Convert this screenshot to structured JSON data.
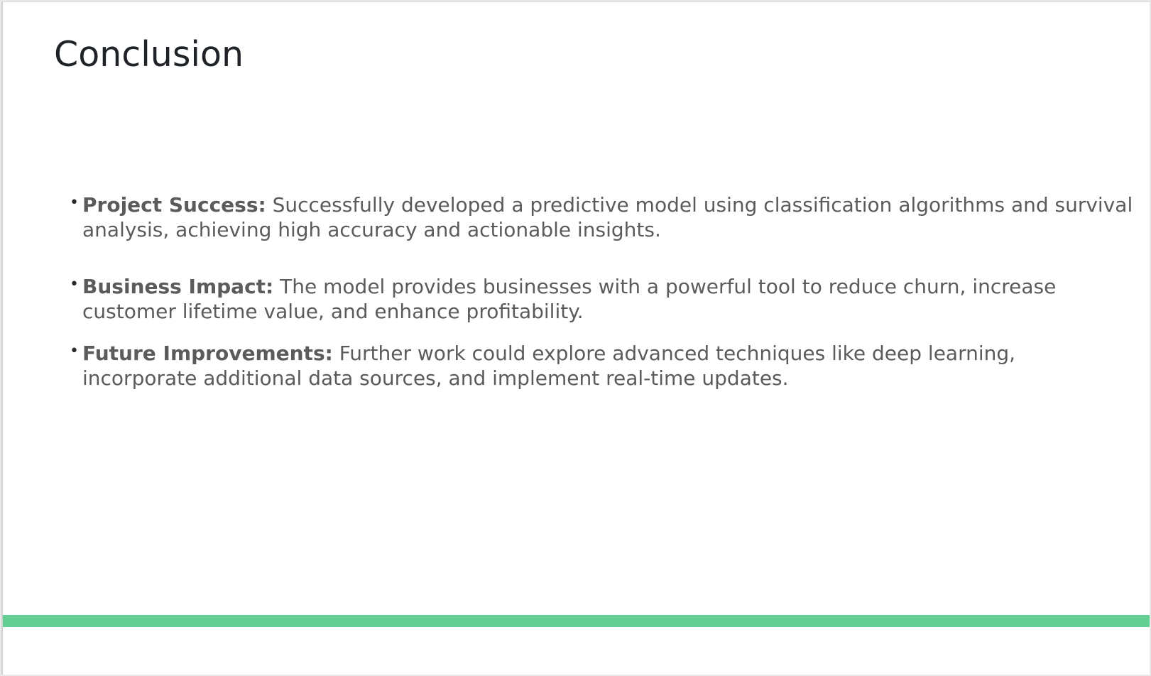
{
  "slide": {
    "title": "Conclusion",
    "bullets": [
      {
        "heading": "Project Success:",
        "text": " Successfully developed a predictive model using classification algorithms and survival analysis, achieving high accuracy and actionable insights."
      },
      {
        "heading": "Business Impact:",
        "text": " The model provides businesses with a powerful tool to reduce churn, increase customer lifetime value, and enhance profitability."
      },
      {
        "heading": "Future Improvements:",
        "text": " Further work could explore advanced techniques like deep learning, incorporate additional data sources, and implement real-time updates."
      }
    ],
    "bullet_glyph": "•",
    "accent_color": "#63cf94",
    "text_color": "#5b5b5b",
    "title_color": "#1f2327"
  }
}
